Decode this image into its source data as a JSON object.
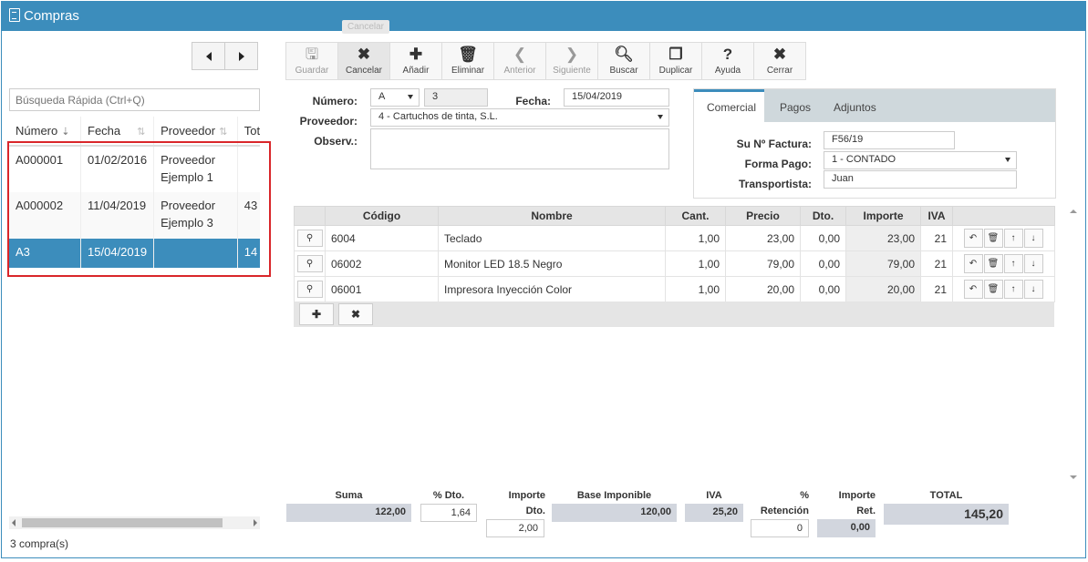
{
  "window": {
    "title": "Compras"
  },
  "tooltip": "Cancelar",
  "sidebar": {
    "search_placeholder": "Búsqueda Rápida (Ctrl+Q)",
    "columns": [
      "Número",
      "Fecha",
      "Proveedor",
      "Total"
    ],
    "rows": [
      {
        "numero": "A000001",
        "fecha": "01/02/2016",
        "proveedor_l1": "Proveedor",
        "proveedor_l2": "Ejemplo 1",
        "total": ""
      },
      {
        "numero": "A000002",
        "fecha": "11/04/2019",
        "proveedor_l1": "Proveedor",
        "proveedor_l2": "Ejemplo 3",
        "total": "43"
      },
      {
        "numero": "A3",
        "fecha": "15/04/2019",
        "proveedor_l1": "",
        "proveedor_l2": "",
        "total": "14"
      }
    ],
    "count": "3 compra(s)"
  },
  "toolbar": [
    {
      "label": "Guardar",
      "icon": "save-icon",
      "glyph": "🖫",
      "disabled": true
    },
    {
      "label": "Cancelar",
      "icon": "x-icon",
      "glyph": "✖",
      "disabled": false,
      "active": true
    },
    {
      "label": "Añadir",
      "icon": "plus-icon",
      "glyph": "✚",
      "disabled": false
    },
    {
      "label": "Eliminar",
      "icon": "trash-icon",
      "glyph": "🗑",
      "disabled": false
    },
    {
      "label": "Anterior",
      "icon": "chevron-left-icon",
      "glyph": "❮",
      "disabled": true
    },
    {
      "label": "Siguiente",
      "icon": "chevron-right-icon",
      "glyph": "❯",
      "disabled": true
    },
    {
      "label": "Buscar",
      "icon": "search-icon",
      "glyph": "🔍︎",
      "disabled": false
    },
    {
      "label": "Duplicar",
      "icon": "copy-icon",
      "glyph": "❐",
      "disabled": false
    },
    {
      "label": "Ayuda",
      "icon": "help-icon",
      "glyph": "?",
      "disabled": false
    },
    {
      "label": "Cerrar",
      "icon": "close-icon",
      "glyph": "✖",
      "disabled": false
    }
  ],
  "form": {
    "numero_label": "Número:",
    "serie": "A",
    "numero": "3",
    "fecha_label": "Fecha:",
    "fecha": "15/04/2019",
    "proveedor_label": "Proveedor:",
    "proveedor": "4 - Cartuchos de tinta, S.L.",
    "observ_label": "Observ.:",
    "observ": ""
  },
  "tabs": {
    "items": [
      "Comercial",
      "Pagos",
      "Adjuntos"
    ],
    "comercial": {
      "factura_label": "Su Nº Factura:",
      "factura": "F56/19",
      "forma_pago_label": "Forma Pago:",
      "forma_pago": "1 - CONTADO",
      "transportista_label": "Transportista:",
      "transportista": "Juan"
    }
  },
  "lines": {
    "columns": [
      "Código",
      "Nombre",
      "Cant.",
      "Precio",
      "Dto.",
      "Importe",
      "IVA"
    ],
    "rows": [
      {
        "codigo": "6004",
        "nombre": "Teclado",
        "cant": "1,00",
        "precio": "23,00",
        "dto": "0,00",
        "importe": "23,00",
        "iva": "21"
      },
      {
        "codigo": "06002",
        "nombre": "Monitor LED 18.5 Negro",
        "cant": "1,00",
        "precio": "79,00",
        "dto": "0,00",
        "importe": "79,00",
        "iva": "21"
      },
      {
        "codigo": "06001",
        "nombre": "Impresora Inyección Color",
        "cant": "1,00",
        "precio": "20,00",
        "dto": "0,00",
        "importe": "20,00",
        "iva": "21"
      }
    ]
  },
  "totals": {
    "suma_label": "Suma",
    "suma": "122,00",
    "pdto_label": "% Dto.",
    "pdto": "1,64",
    "imp_dto_label_1": "Importe",
    "imp_dto_label_2": "Dto.",
    "imp_dto": "2,00",
    "base_label": "Base Imponible",
    "base": "120,00",
    "iva_label": "IVA",
    "iva": "25,20",
    "pret_label_1": "%",
    "pret_label_2": "Retención",
    "pret": "0",
    "imp_ret_label_1": "Importe",
    "imp_ret_label_2": "Ret.",
    "imp_ret": "0,00",
    "total_label": "TOTAL",
    "total": "145,20"
  }
}
